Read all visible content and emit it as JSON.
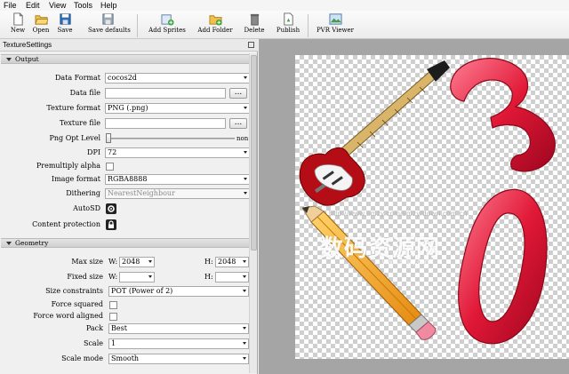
{
  "menu": [
    "File",
    "Edit",
    "View",
    "Tools",
    "Help"
  ],
  "toolbar": {
    "new_label": "New",
    "open_label": "Open",
    "save_label": "Save",
    "save_defaults_label": "Save defaults",
    "add_sprites_label": "Add Sprites",
    "add_folder_label": "Add Folder",
    "delete_label": "Delete",
    "publish_label": "Publish",
    "pvr_viewer_label": "PVR Viewer"
  },
  "panel": {
    "title": "TextureSettings",
    "output": {
      "header": "Output",
      "data_format_label": "Data Format",
      "data_format_value": "cocos2d",
      "data_file_label": "Data file",
      "data_file_value": "",
      "browse_label": "...",
      "texture_format_label": "Texture format",
      "texture_format_value": "PNG (.png)",
      "texture_file_label": "Texture file",
      "texture_file_value": "",
      "png_opt_label": "Png Opt Level",
      "png_opt_value_text": "non",
      "png_opt_level": 0,
      "dpi_label": "DPI",
      "dpi_value": "72",
      "premultiply_label": "Premultiply alpha",
      "premultiply_checked": false,
      "image_format_label": "Image format",
      "image_format_value": "RGBA8888",
      "dithering_label": "Dithering",
      "dithering_value": "NearestNeighbour",
      "autosd_label": "AutoSD",
      "content_protection_label": "Content protection"
    },
    "geometry": {
      "header": "Geometry",
      "max_size_label": "Max size",
      "w_label": "W:",
      "h_label": "H:",
      "max_w": "2048",
      "max_h": "2048",
      "fixed_size_label": "Fixed size",
      "fixed_w": "",
      "fixed_h": "",
      "size_constraints_label": "Size constraints",
      "size_constraints_value": "POT (Power of 2)",
      "force_squared_label": "Force squared",
      "force_squared_checked": false,
      "force_word_label": "Force word aligned",
      "force_word_checked": false,
      "pack_label": "Pack",
      "pack_value": "Best",
      "scale_label": "Scale",
      "scale_value": "1",
      "scale_mode_label": "Scale mode",
      "scale_mode_value": "Smooth"
    }
  },
  "canvas": {
    "sprites": [
      "electric-guitar",
      "pencil",
      "digit-3",
      "digit-0"
    ],
    "watermark_url_line": "http://www.smzy.com/smzy/down.com.cn",
    "watermark_cn": "数码资源网",
    "watermark_url": "www.smzy.com"
  },
  "colors": {
    "accent": "#d8102a",
    "canvas_bg": "#a5a5a5",
    "checker": "#cfcfcf"
  }
}
